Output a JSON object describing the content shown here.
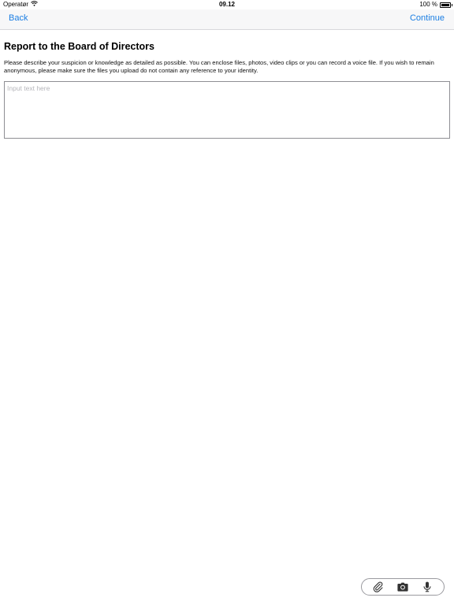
{
  "status_bar": {
    "carrier": "Operatør",
    "time": "09.12",
    "battery": "100 %",
    "battery_level": 1.0
  },
  "nav": {
    "back_label": "Back",
    "continue_label": "Continue"
  },
  "main": {
    "title": "Report to the Board of Directors",
    "description": "Please describe your suspicion or knowledge as detailed as possible. You can enclose files, photos, video clips or you can record a voice file. If you wish to remain anonymous, please make sure the files you upload do not contain any reference to your identity.",
    "input_placeholder": "Input text here",
    "input_value": ""
  },
  "toolbar": {
    "icons": [
      "paperclip-icon",
      "camera-icon",
      "microphone-icon"
    ]
  },
  "colors": {
    "accent": "#1b7ee3",
    "nav_background": "#f7f7f8"
  }
}
